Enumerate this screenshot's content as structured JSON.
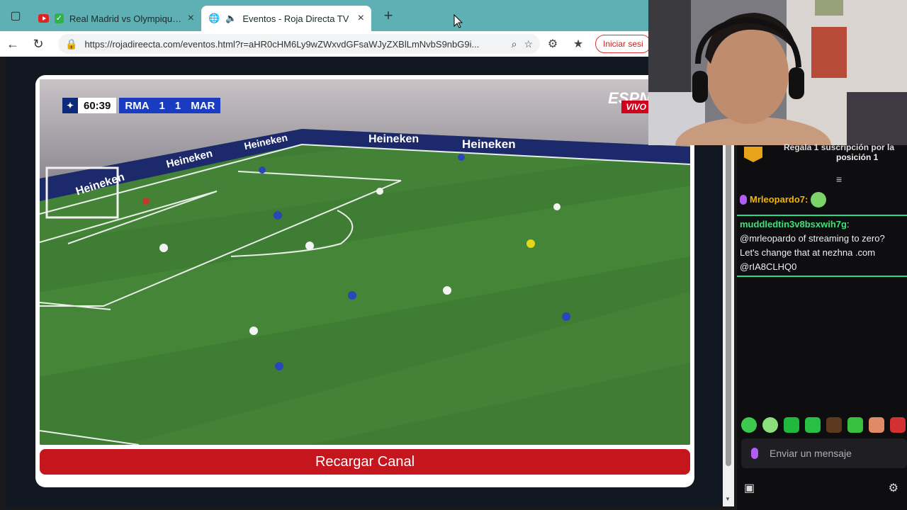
{
  "browser": {
    "tabs": [
      {
        "title": "Real Madrid vs Olympique de",
        "close": "×"
      },
      {
        "title": "Eventos - Roja Directa TV",
        "close": "×"
      }
    ],
    "newtab": "+",
    "url": "https://rojadireecta.com/eventos.html?r=aHR0cHM6Ly9wZWxvdGFsaWJyZXBlLmNvbS9nbG9i...",
    "signin": "Iniciar sesi"
  },
  "video": {
    "clock": "60:39",
    "home": "RMA",
    "home_score": "1",
    "away_score": "1",
    "away": "MAR",
    "broadcaster": "ESPN",
    "live": "VIVO",
    "boards": [
      "Heineken",
      "Heineken",
      "Heineken",
      "Heineken",
      "Heineken"
    ]
  },
  "reload_label": "Recargar Canal",
  "chat": {
    "banner_line1": "Regala 1 suscripción por la",
    "banner_line2": "posición 1",
    "messages": [
      {
        "user": "Mrleopardo7:",
        "text": ""
      },
      {
        "user": "muddledtin3v8bsxwih7g",
        "text": ": @mrleopardo of streaming to zero? Let's change that at nezhna .com @rIA8CLHQ0"
      }
    ],
    "input_placeholder": "Enviar un mensaje"
  },
  "colors": {
    "tabstrip": "#5fb0b5",
    "reload_button": "#c5161d",
    "pitch": "#3f7a35",
    "chat_bg": "#0e0e10",
    "username_gold": "#f5b400",
    "username_green": "#3ee27a"
  }
}
